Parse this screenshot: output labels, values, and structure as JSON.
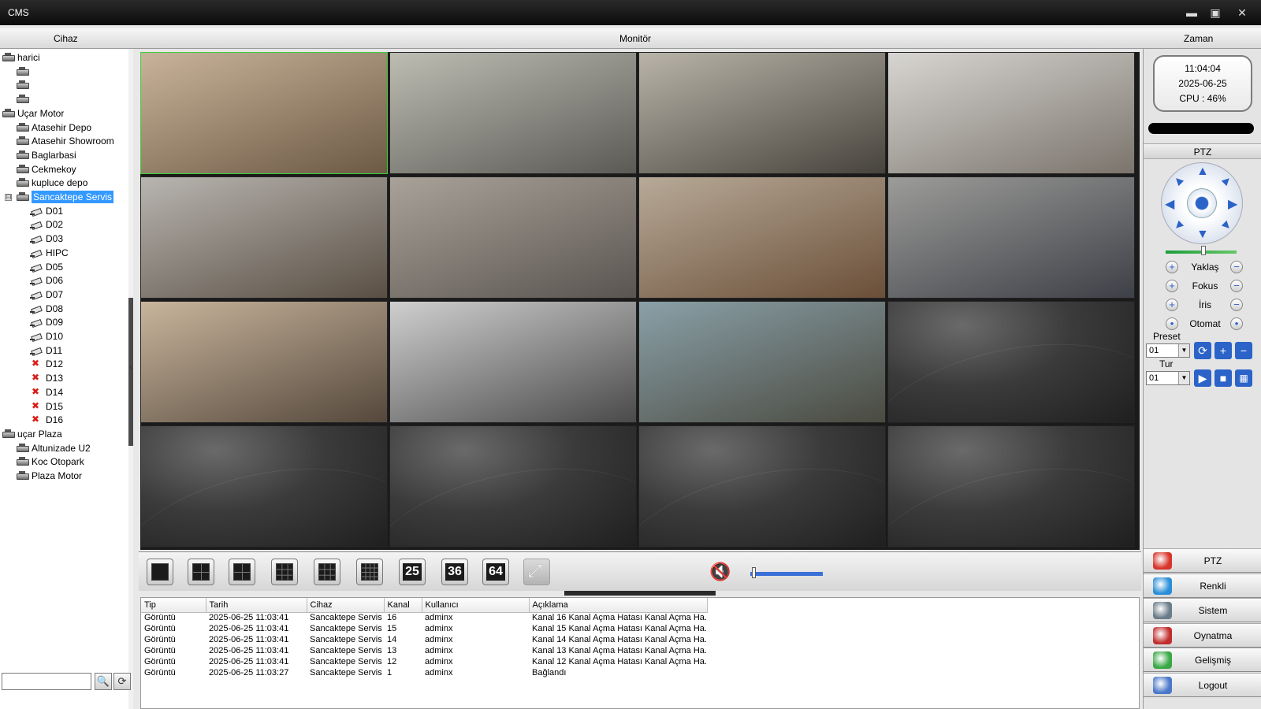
{
  "window": {
    "title": "CMS",
    "min": "▬",
    "max": "▣",
    "close": "✕"
  },
  "header": {
    "left": "Cihaz",
    "center": "Monitör",
    "right": "Zaman"
  },
  "tree": [
    {
      "label": "harici",
      "level": 0,
      "icon": "dvr",
      "expanded": true
    },
    {
      "label": "",
      "level": 1,
      "icon": "dvr"
    },
    {
      "label": "",
      "level": 1,
      "icon": "dvr"
    },
    {
      "label": "",
      "level": 1,
      "icon": "dvr"
    },
    {
      "label": "Uçar Motor",
      "level": 0,
      "icon": "dvr",
      "expanded": true
    },
    {
      "label": "Atasehir Depo",
      "level": 1,
      "icon": "dvr"
    },
    {
      "label": "Atasehir Showroom",
      "level": 1,
      "icon": "dvr"
    },
    {
      "label": "Baglarbasi",
      "level": 1,
      "icon": "dvr"
    },
    {
      "label": "Cekmekoy",
      "level": 1,
      "icon": "dvr"
    },
    {
      "label": "kupluce depo",
      "level": 1,
      "icon": "dvr"
    },
    {
      "label": "Sancaktepe Servis",
      "level": 1,
      "icon": "dvr",
      "selected": true,
      "expander": "⊟"
    },
    {
      "label": "D01",
      "level": 2,
      "icon": "cam"
    },
    {
      "label": "D02",
      "level": 2,
      "icon": "cam"
    },
    {
      "label": "D03",
      "level": 2,
      "icon": "cam"
    },
    {
      "label": "HIPC",
      "level": 2,
      "icon": "cam"
    },
    {
      "label": "D05",
      "level": 2,
      "icon": "cam"
    },
    {
      "label": "D06",
      "level": 2,
      "icon": "cam"
    },
    {
      "label": "D07",
      "level": 2,
      "icon": "cam"
    },
    {
      "label": "D08",
      "level": 2,
      "icon": "cam"
    },
    {
      "label": "D09",
      "level": 2,
      "icon": "cam"
    },
    {
      "label": "D10",
      "level": 2,
      "icon": "cam"
    },
    {
      "label": "D11",
      "level": 2,
      "icon": "cam"
    },
    {
      "label": "D12",
      "level": 2,
      "icon": "camx"
    },
    {
      "label": "D13",
      "level": 2,
      "icon": "camx"
    },
    {
      "label": "D14",
      "level": 2,
      "icon": "camx"
    },
    {
      "label": "D15",
      "level": 2,
      "icon": "camx"
    },
    {
      "label": "D16",
      "level": 2,
      "icon": "camx"
    },
    {
      "label": "uçar Plaza",
      "level": 0,
      "icon": "dvr",
      "expanded": true
    },
    {
      "label": "Altunizade U2",
      "level": 1,
      "icon": "dvr"
    },
    {
      "label": "Koc Otopark",
      "level": 1,
      "icon": "dvr"
    },
    {
      "label": "Plaza Motor",
      "level": 1,
      "icon": "dvr"
    }
  ],
  "search": {
    "placeholder": "",
    "search_icon": "🔍",
    "refresh_icon": "⟳"
  },
  "tiles": [
    {
      "state": "live",
      "colors": [
        "#c9b39a",
        "#6d5a45"
      ],
      "active": true
    },
    {
      "state": "live",
      "colors": [
        "#bdbdb3",
        "#5b5a55"
      ]
    },
    {
      "state": "live",
      "colors": [
        "#b9b4a9",
        "#47443d"
      ]
    },
    {
      "state": "live",
      "colors": [
        "#d8d6d2",
        "#7a746c"
      ]
    },
    {
      "state": "live",
      "colors": [
        "#b8b5b0",
        "#5a4f44"
      ]
    },
    {
      "state": "live",
      "colors": [
        "#a9a299",
        "#5a5550"
      ]
    },
    {
      "state": "live",
      "colors": [
        "#b7aa98",
        "#6b4f38"
      ]
    },
    {
      "state": "live",
      "colors": [
        "#9c9c99",
        "#3e4047"
      ]
    },
    {
      "state": "live",
      "colors": [
        "#c8b59c",
        "#55483c"
      ]
    },
    {
      "state": "live",
      "colors": [
        "#cfcfcf",
        "#4a4a4a"
      ]
    },
    {
      "state": "live",
      "colors": [
        "#8aa0a8",
        "#4a4a40"
      ]
    },
    {
      "state": "empty"
    },
    {
      "state": "empty"
    },
    {
      "state": "empty"
    },
    {
      "state": "empty"
    },
    {
      "state": "empty"
    }
  ],
  "clock": {
    "time": "11:04:04",
    "date": "2025-06-25",
    "cpu": "CPU : 46%"
  },
  "ptz": {
    "title": "PTZ",
    "zoom": "Yaklaş",
    "focus": "Fokus",
    "iris": "İris",
    "auto": "Otomat",
    "preset_label": "Preset",
    "preset_value": "01",
    "tour_label": "Tur",
    "tour_value": "01",
    "speed": 0.5
  },
  "layouts": [
    "",
    "",
    "",
    "",
    "",
    "",
    "25",
    "36",
    "64"
  ],
  "volume": {
    "level": 0.02
  },
  "menu": [
    {
      "label": "PTZ",
      "color": "#d8342a"
    },
    {
      "label": "Renkli",
      "color": "#2a8fd8"
    },
    {
      "label": "Sistem",
      "color": "#6a7d8a"
    },
    {
      "label": "Oynatma",
      "color": "#c22e2e"
    },
    {
      "label": "Gelişmiş",
      "color": "#3aa845"
    },
    {
      "label": "Logout",
      "color": "#4b78c8"
    }
  ],
  "log": {
    "columns": [
      "Tip",
      "Tarih",
      "Cihaz",
      "Kanal",
      "Kullanıcı",
      "Açıklama"
    ],
    "rows": [
      [
        "Görüntü",
        "2025-06-25 11:03:41",
        "Sancaktepe Servis",
        "16",
        "adminx",
        "Kanal 16 Kanal Açma Hatası Kanal Açma Ha..."
      ],
      [
        "Görüntü",
        "2025-06-25 11:03:41",
        "Sancaktepe Servis",
        "15",
        "adminx",
        "Kanal 15 Kanal Açma Hatası Kanal Açma Ha..."
      ],
      [
        "Görüntü",
        "2025-06-25 11:03:41",
        "Sancaktepe Servis",
        "14",
        "adminx",
        "Kanal 14 Kanal Açma Hatası Kanal Açma Ha..."
      ],
      [
        "Görüntü",
        "2025-06-25 11:03:41",
        "Sancaktepe Servis",
        "13",
        "adminx",
        "Kanal 13 Kanal Açma Hatası Kanal Açma Ha..."
      ],
      [
        "Görüntü",
        "2025-06-25 11:03:41",
        "Sancaktepe Servis",
        "12",
        "adminx",
        "Kanal 12 Kanal Açma Hatası Kanal Açma Ha..."
      ],
      [
        "Görüntü",
        "2025-06-25 11:03:27",
        "Sancaktepe Servis",
        "1",
        "adminx",
        "Bağlandı"
      ]
    ]
  }
}
